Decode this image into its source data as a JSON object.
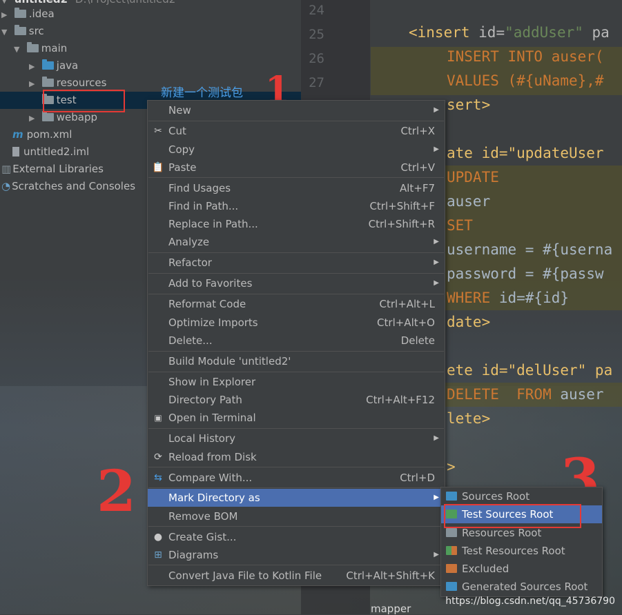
{
  "tree": {
    "root_label": "untitled2",
    "root_path": "D:\\Project\\untitled2",
    "items": [
      {
        "label": ".idea"
      },
      {
        "label": "src"
      },
      {
        "label": "main"
      },
      {
        "label": "java"
      },
      {
        "label": "resources"
      },
      {
        "label": "test"
      },
      {
        "label": "webapp"
      },
      {
        "label": "pom.xml"
      },
      {
        "label": "untitled2.iml"
      },
      {
        "label": "External Libraries"
      },
      {
        "label": "Scratches and Consoles"
      }
    ]
  },
  "editor": {
    "line_numbers": [
      "24",
      "25",
      "26",
      "27"
    ],
    "lines": [
      {
        "tag": "<insert",
        "attr": " id=",
        "str": "\"addUser\"",
        "tail": " pa"
      },
      {
        "sql": "INSERT INTO auser("
      },
      {
        "sql": "VALUES (#{uName},#"
      },
      {
        "plain": "sert>"
      },
      {
        "plain": "ate id=\"updateUser"
      },
      {
        "sql": "UPDATE"
      },
      {
        "plain": "auser"
      },
      {
        "sql": "SET"
      },
      {
        "plain": "username = #{userna"
      },
      {
        "plain": "password = #{passw"
      },
      {
        "sql": "WHERE",
        "plain": " id=#{id}"
      },
      {
        "plain": "date>"
      },
      {
        "plain": "ete id=\"delUser\" pa"
      },
      {
        "sql": "DELETE  FROM",
        "plain": " auser"
      },
      {
        "plain": "lete>"
      },
      {
        "plain": ">"
      }
    ]
  },
  "annotations": {
    "note": "新建一个测试包",
    "marker_1": "1",
    "marker_2": "2",
    "marker_3": "3"
  },
  "context_menu": {
    "items": [
      {
        "label": "New",
        "shortcut": "",
        "submenu": true,
        "icon": ""
      },
      {
        "label": "Cut",
        "shortcut": "Ctrl+X",
        "submenu": false,
        "icon": "scissors-icon"
      },
      {
        "label": "Copy",
        "shortcut": "",
        "submenu": true,
        "icon": ""
      },
      {
        "label": "Paste",
        "shortcut": "Ctrl+V",
        "submenu": false,
        "icon": "clipboard-icon"
      },
      {
        "label": "Find Usages",
        "shortcut": "Alt+F7",
        "submenu": false,
        "icon": ""
      },
      {
        "label": "Find in Path...",
        "shortcut": "Ctrl+Shift+F",
        "submenu": false,
        "icon": ""
      },
      {
        "label": "Replace in Path...",
        "shortcut": "Ctrl+Shift+R",
        "submenu": false,
        "icon": ""
      },
      {
        "label": "Analyze",
        "shortcut": "",
        "submenu": true,
        "icon": ""
      },
      {
        "label": "Refactor",
        "shortcut": "",
        "submenu": true,
        "icon": ""
      },
      {
        "label": "Add to Favorites",
        "shortcut": "",
        "submenu": true,
        "icon": ""
      },
      {
        "label": "Reformat Code",
        "shortcut": "Ctrl+Alt+L",
        "submenu": false,
        "icon": ""
      },
      {
        "label": "Optimize Imports",
        "shortcut": "Ctrl+Alt+O",
        "submenu": false,
        "icon": ""
      },
      {
        "label": "Delete...",
        "shortcut": "Delete",
        "submenu": false,
        "icon": ""
      },
      {
        "label": "Build Module 'untitled2'",
        "shortcut": "",
        "submenu": false,
        "icon": ""
      },
      {
        "label": "Show in Explorer",
        "shortcut": "",
        "submenu": false,
        "icon": ""
      },
      {
        "label": "Directory Path",
        "shortcut": "Ctrl+Alt+F12",
        "submenu": false,
        "icon": ""
      },
      {
        "label": "Open in Terminal",
        "shortcut": "",
        "submenu": false,
        "icon": "terminal-icon"
      },
      {
        "label": "Local History",
        "shortcut": "",
        "submenu": true,
        "icon": ""
      },
      {
        "label": "Reload from Disk",
        "shortcut": "",
        "submenu": false,
        "icon": "reload-icon"
      },
      {
        "label": "Compare With...",
        "shortcut": "Ctrl+D",
        "submenu": false,
        "icon": "compare-icon"
      },
      {
        "label": "Mark Directory as",
        "shortcut": "",
        "submenu": true,
        "icon": ""
      },
      {
        "label": "Remove BOM",
        "shortcut": "",
        "submenu": false,
        "icon": ""
      },
      {
        "label": "Create Gist...",
        "shortcut": "",
        "submenu": false,
        "icon": "github-icon"
      },
      {
        "label": "Diagrams",
        "shortcut": "",
        "submenu": true,
        "icon": "diagram-icon"
      },
      {
        "label": "Convert Java File to Kotlin File",
        "shortcut": "Ctrl+Alt+Shift+K",
        "submenu": false,
        "icon": ""
      }
    ]
  },
  "submenu": {
    "items": [
      {
        "label": "Sources Root",
        "color": "#3f8fc4"
      },
      {
        "label": "Test Sources Root",
        "color": "#4f9c5a"
      },
      {
        "label": "Resources Root",
        "color": "#87939a"
      },
      {
        "label": "Test Resources Root",
        "color": "#87939a"
      },
      {
        "label": "Excluded",
        "color": "#c9733a"
      },
      {
        "label": "Generated Sources Root",
        "color": "#3f8fc4"
      }
    ]
  },
  "footer": {
    "watermark": "https://blog.csdn.net/qq_45736790",
    "tab_label": "mapper"
  },
  "colors": {
    "menu_bg": "#3c3f41",
    "selection": "#4b6eaf",
    "annotation_red": "#e53935",
    "annotation_blue": "#4b9fe8"
  }
}
